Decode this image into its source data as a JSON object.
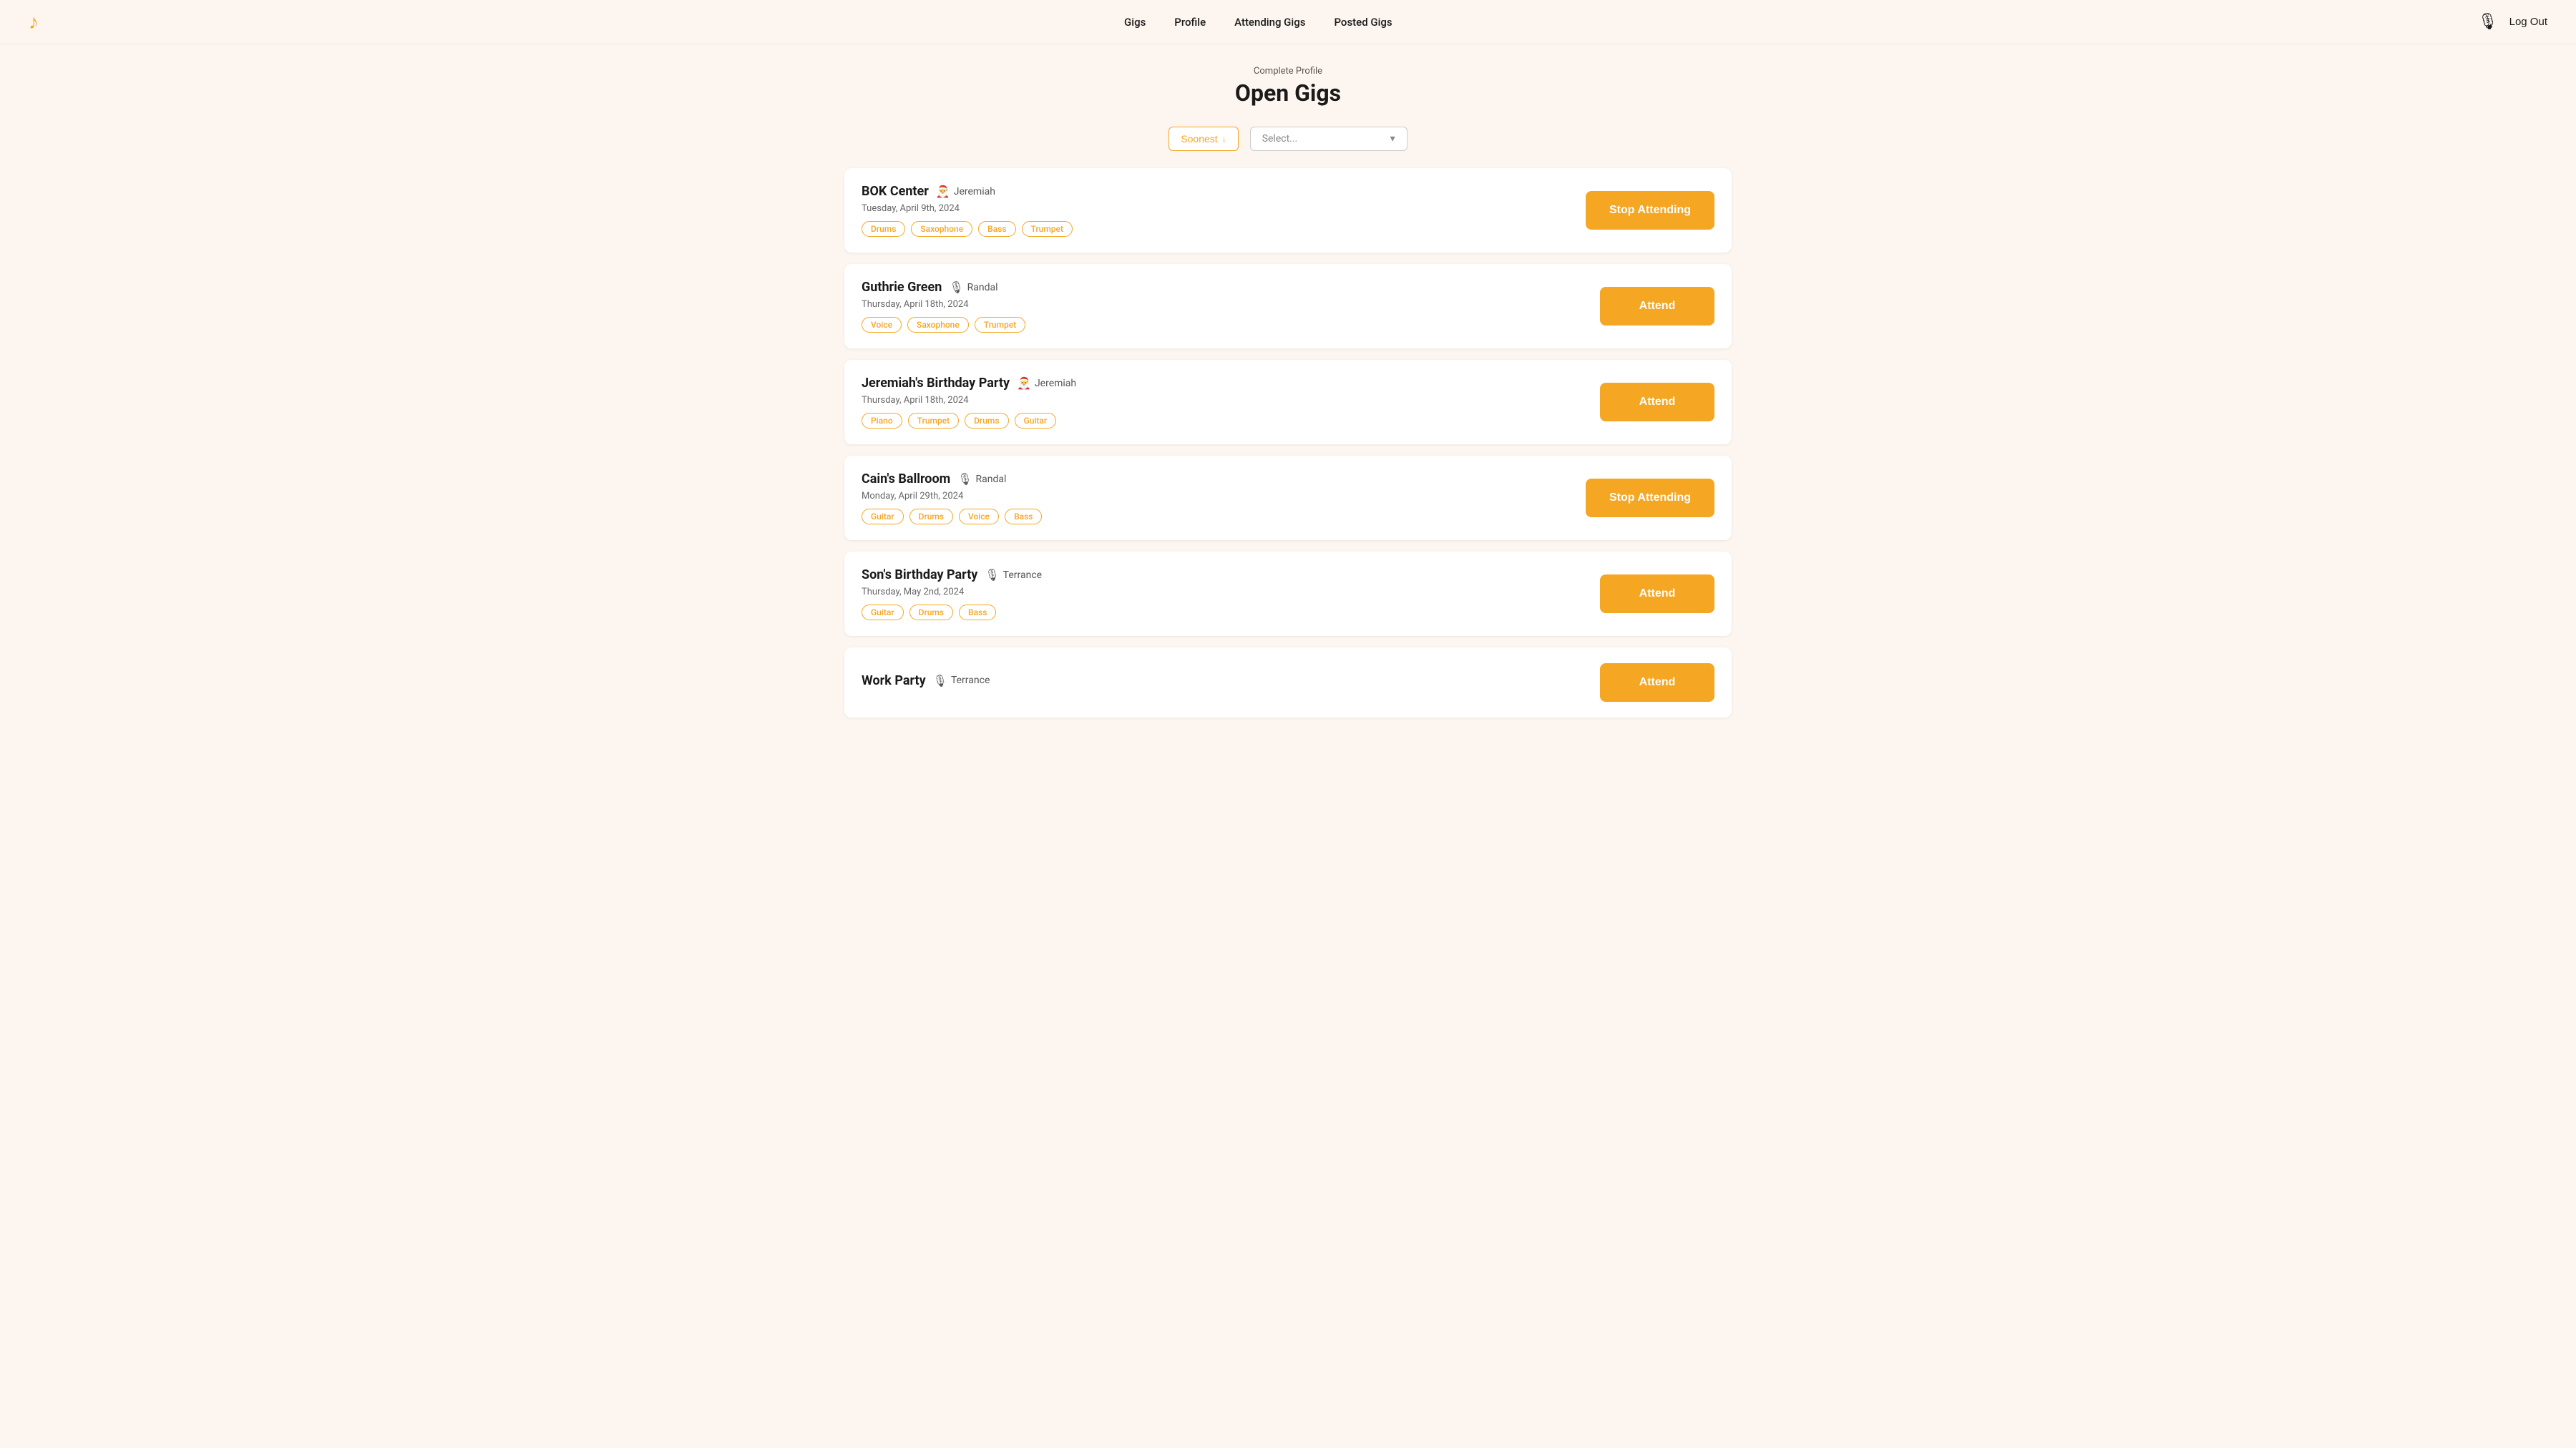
{
  "nav": {
    "logo": "♪",
    "links": [
      "Gigs",
      "Profile",
      "Attending Gigs",
      "Posted Gigs"
    ],
    "user_icon": "🎙",
    "logout_label": "Log Out"
  },
  "header": {
    "subtitle": "Complete Profile",
    "title": "Open Gigs"
  },
  "filters": {
    "sort_label": "Soonest",
    "sort_icon": "↓",
    "select_placeholder": "Select...",
    "select_icon": "▾"
  },
  "gigs": [
    {
      "id": 1,
      "title": "BOK Center",
      "host_icon": "🎅",
      "host": "Jeremiah",
      "date": "Tuesday, April 9th, 2024",
      "tags": [
        "Drums",
        "Saxophone",
        "Bass",
        "Trumpet"
      ],
      "action": "Stop Attending",
      "action_type": "stop"
    },
    {
      "id": 2,
      "title": "Guthrie Green",
      "host_icon": "🎙",
      "host": "Randal",
      "date": "Thursday, April 18th, 2024",
      "tags": [
        "Voice",
        "Saxophone",
        "Trumpet"
      ],
      "action": "Attend",
      "action_type": "attend"
    },
    {
      "id": 3,
      "title": "Jeremiah's Birthday Party",
      "host_icon": "🎅",
      "host": "Jeremiah",
      "date": "Thursday, April 18th, 2024",
      "tags": [
        "Piano",
        "Trumpet",
        "Drums",
        "Guitar"
      ],
      "action": "Attend",
      "action_type": "attend"
    },
    {
      "id": 4,
      "title": "Cain's Ballroom",
      "host_icon": "🎙",
      "host": "Randal",
      "date": "Monday, April 29th, 2024",
      "tags": [
        "Guitar",
        "Drums",
        "Voice",
        "Bass"
      ],
      "action": "Stop Attending",
      "action_type": "stop"
    },
    {
      "id": 5,
      "title": "Son's Birthday Party",
      "host_icon": "🎙",
      "host": "Terrance",
      "date": "Thursday, May 2nd, 2024",
      "tags": [
        "Guitar",
        "Drums",
        "Bass"
      ],
      "action": "Attend",
      "action_type": "attend"
    },
    {
      "id": 6,
      "title": "Work Party",
      "host_icon": "🎙",
      "host": "Terrance",
      "date": "",
      "tags": [],
      "action": "Attend",
      "action_type": "attend"
    }
  ]
}
